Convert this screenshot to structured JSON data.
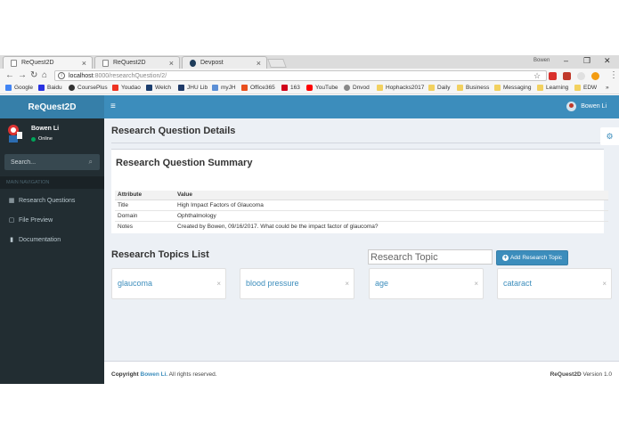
{
  "browser": {
    "tabs": [
      {
        "title": "ReQuest2D",
        "active": true
      },
      {
        "title": "ReQuest2D",
        "active": false
      },
      {
        "title": "Devpost",
        "active": false
      }
    ],
    "profile_label": "Bowen",
    "url_host": "localhost",
    "url_path": ":8000/researchQuestion/2/",
    "bookmarks": [
      {
        "label": "Google",
        "icon": "google-icon"
      },
      {
        "label": "Baidu",
        "icon": "baidu-icon"
      },
      {
        "label": "CoursePlus",
        "icon": "courseplus-icon"
      },
      {
        "label": "Youdao",
        "icon": "youdao-icon"
      },
      {
        "label": "Welch",
        "icon": "welch-icon"
      },
      {
        "label": "JHU Lib",
        "icon": "jhu-icon"
      },
      {
        "label": "myJH",
        "icon": "myjh-icon"
      },
      {
        "label": "Office365",
        "icon": "office-icon"
      },
      {
        "label": "163",
        "icon": "163-icon"
      },
      {
        "label": "YouTube",
        "icon": "youtube-icon"
      },
      {
        "label": "Dnvod",
        "icon": "dnvod-icon"
      },
      {
        "label": "Hophacks2017",
        "icon": "folder-icon"
      },
      {
        "label": "Daily",
        "icon": "folder-icon"
      },
      {
        "label": "Business",
        "icon": "folder-icon"
      },
      {
        "label": "Messaging",
        "icon": "folder-icon"
      },
      {
        "label": "Learning",
        "icon": "folder-icon"
      },
      {
        "label": "EDW",
        "icon": "folder-icon"
      }
    ],
    "more": "»"
  },
  "app": {
    "logo": "ReQuest2D",
    "header_user": "Bowen Li",
    "sidebar": {
      "user_name": "Bowen Li",
      "status": "Online",
      "search_placeholder": "Search...",
      "nav_header": "MAIN NAVIGATION",
      "items": [
        {
          "label": "Research Questions",
          "icon": "table-icon"
        },
        {
          "label": "File Preview",
          "icon": "file-icon"
        },
        {
          "label": "Documentation",
          "icon": "book-icon"
        }
      ]
    },
    "page_title": "Research Question Details",
    "summary": {
      "title": "Research Question Summary",
      "columns": [
        "Attribute",
        "Value"
      ],
      "rows": [
        [
          "Title",
          "High Impact Factors of Glaucoma"
        ],
        [
          "Domain",
          "Ophthalmology"
        ],
        [
          "Notes",
          "Created by Bowen, 09/16/2017. What could be the impact factor of glaucoma?"
        ]
      ]
    },
    "topics": {
      "title": "Research Topics List",
      "input_placeholder": "Research Topic",
      "add_button": "Add Research Topic",
      "items": [
        "glaucoma",
        "blood pressure",
        "age",
        "cataract"
      ],
      "remove_glyph": "×"
    },
    "footer": {
      "copyright_prefix": "Copyright",
      "author": "Bowen Li.",
      "suffix": "All rights reserved.",
      "app_name": "ReQuest2D",
      "version": "Version 1.0"
    },
    "colors": {
      "header": "#3c8dbc",
      "logo": "#367fa9",
      "sidebar": "#222d32",
      "content_bg": "#ecf0f5"
    }
  }
}
